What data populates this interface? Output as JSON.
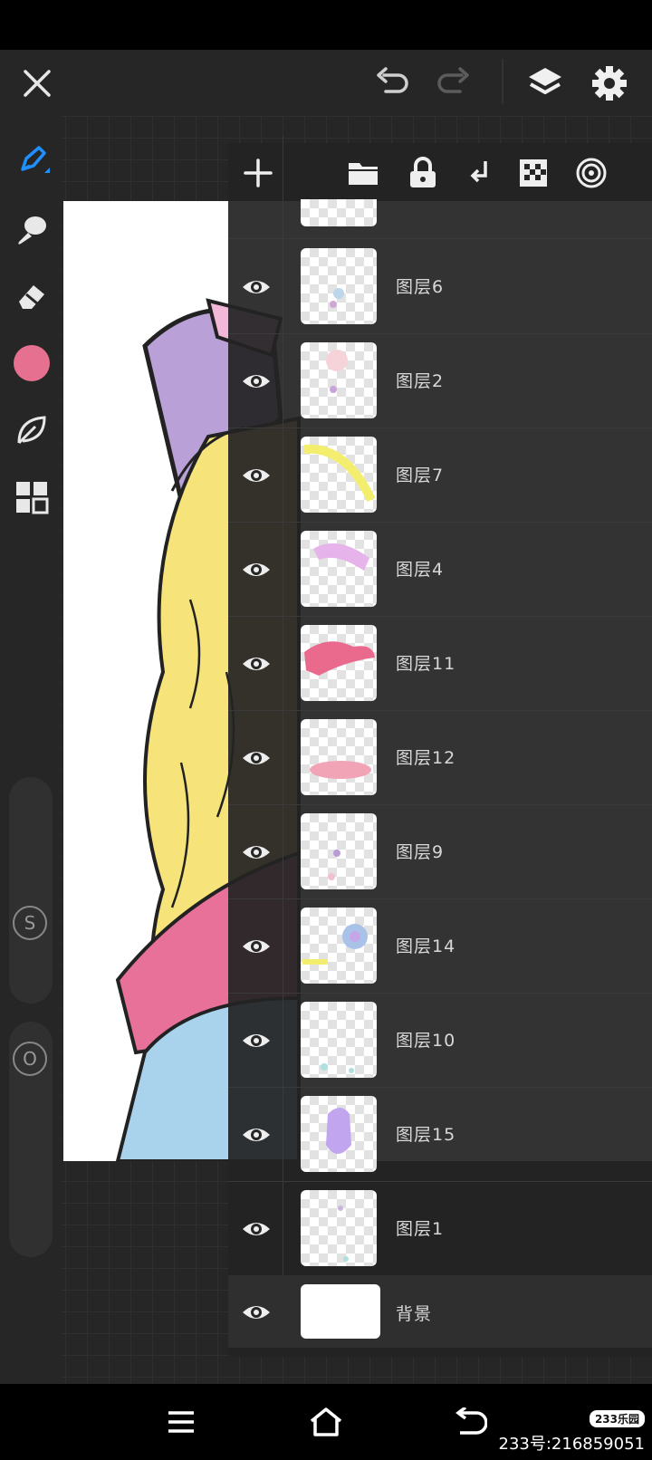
{
  "layers": [
    {
      "name": ""
    },
    {
      "name": "图层6"
    },
    {
      "name": "图层2"
    },
    {
      "name": "图层7"
    },
    {
      "name": "图层4"
    },
    {
      "name": "图层11"
    },
    {
      "name": "图层12"
    },
    {
      "name": "图层9"
    },
    {
      "name": "图层14"
    },
    {
      "name": "图层10"
    },
    {
      "name": "图层15"
    },
    {
      "name": "图层1"
    },
    {
      "name": "背景"
    }
  ],
  "left_sliders": {
    "size_label": "S",
    "opacity_label": "O"
  },
  "watermark": {
    "logo": "233乐园",
    "id_text": "233号:216859051"
  },
  "colors": {
    "current_color": "#e5708f",
    "accent": "#1e90ff"
  },
  "icons": {
    "top": [
      "close-icon",
      "undo-icon",
      "redo-icon",
      "layers-icon",
      "settings-icon"
    ],
    "tools": [
      "pen-icon",
      "smudge-icon",
      "eraser-icon",
      "color-swatch",
      "leaf-icon",
      "grid-icon"
    ],
    "layers_toolbar": [
      "add-icon",
      "folder-icon",
      "lock-icon",
      "merge-down-icon",
      "transparency-icon",
      "blend-target-icon"
    ],
    "nav": [
      "menu-icon",
      "home-icon",
      "back-icon"
    ]
  }
}
